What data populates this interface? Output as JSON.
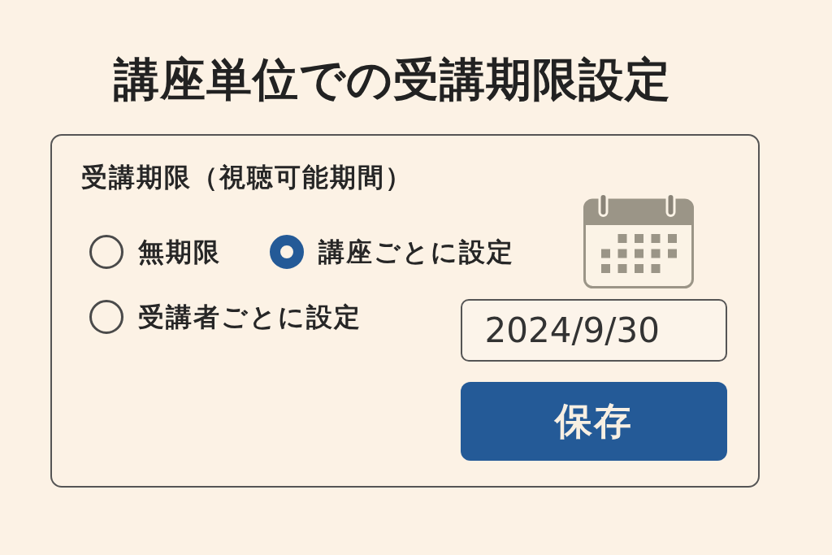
{
  "title": "講座単位での受講期限設定",
  "form": {
    "label": "受講期限（視聴可能期間）",
    "options": [
      {
        "label": "無期限",
        "selected": false
      },
      {
        "label": "講座ごとに設定",
        "selected": true
      },
      {
        "label": "受講者ごとに設定",
        "selected": false
      }
    ],
    "date_field": {
      "value": "2024/9/30"
    },
    "save_button": "保存"
  }
}
